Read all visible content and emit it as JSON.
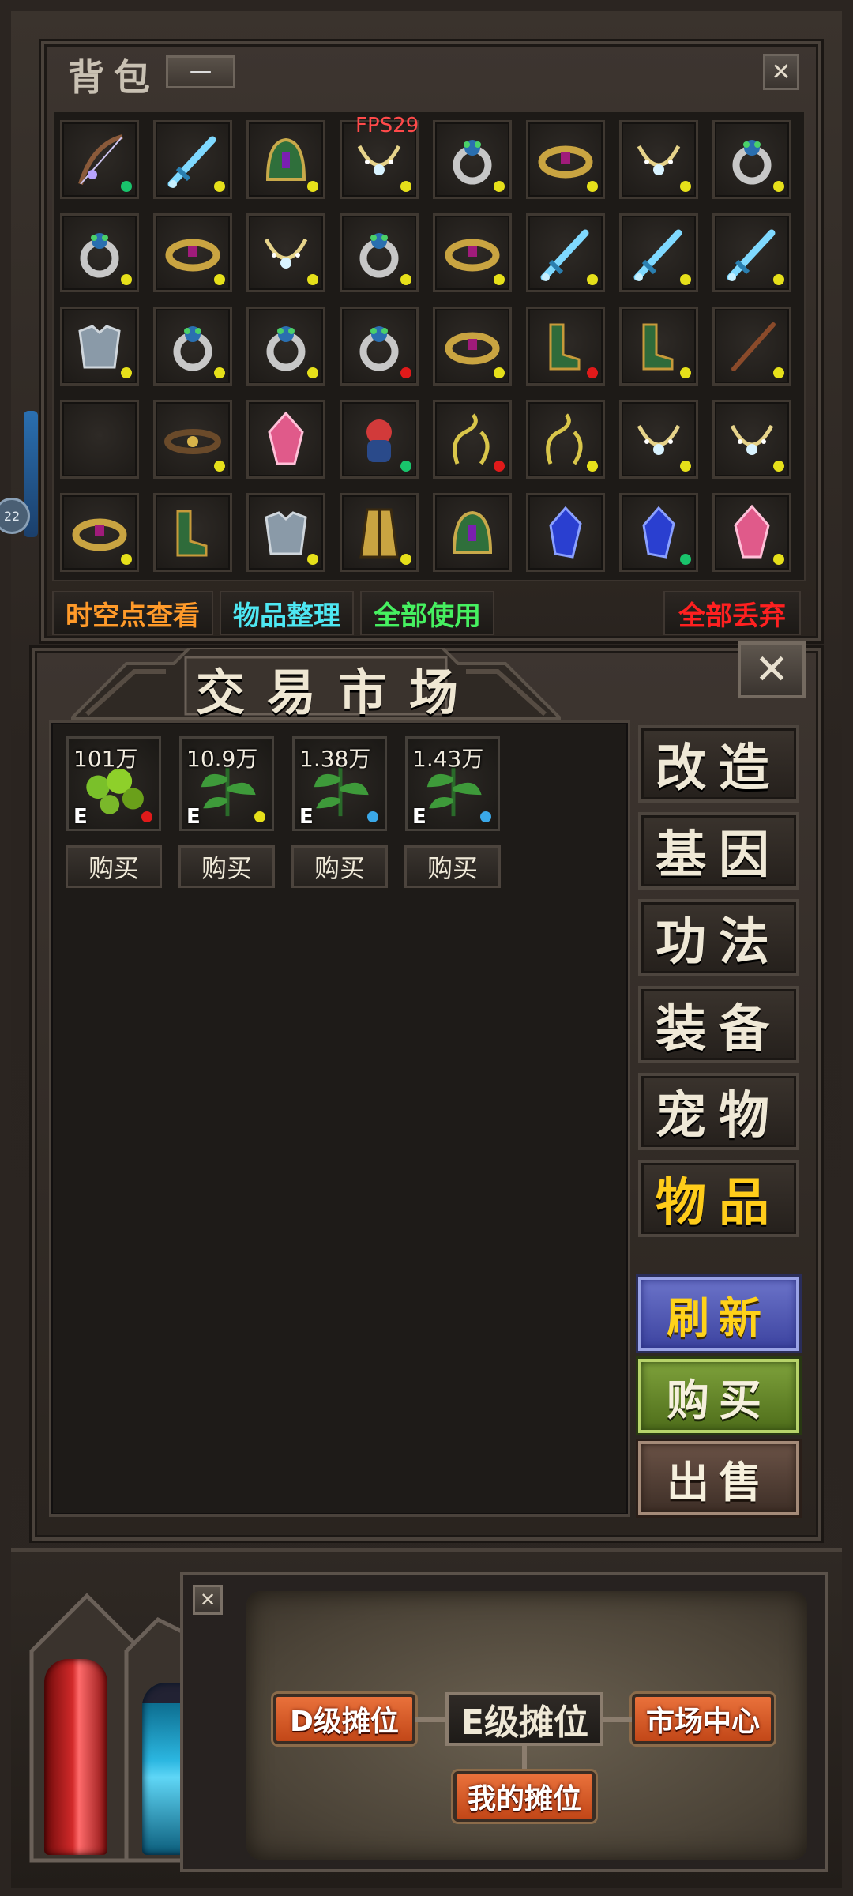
{
  "fps": "FPS29",
  "bag": {
    "title": "背包",
    "minimize_label": "一",
    "close_label": "✕",
    "items": [
      {
        "icon": "bow-icon",
        "dot": "#19c46c"
      },
      {
        "icon": "sword-icon",
        "dot": "#e6e01a"
      },
      {
        "icon": "helmet-icon",
        "dot": "#e6e01a"
      },
      {
        "icon": "necklace-icon",
        "dot": "#e6e01a"
      },
      {
        "icon": "ring-icon",
        "dot": "#e6e01a"
      },
      {
        "icon": "bracelet-icon",
        "dot": "#e6e01a"
      },
      {
        "icon": "necklace-icon",
        "dot": "#e6e01a"
      },
      {
        "icon": "ring-icon",
        "dot": "#e6e01a"
      },
      {
        "icon": "ring-icon",
        "dot": "#e6e01a"
      },
      {
        "icon": "bracelet-icon",
        "dot": "#e6e01a"
      },
      {
        "icon": "necklace-icon",
        "dot": "#e6e01a"
      },
      {
        "icon": "ring-icon",
        "dot": "#e6e01a"
      },
      {
        "icon": "bracelet-icon",
        "dot": "#e6e01a"
      },
      {
        "icon": "sword-icon",
        "dot": "#e6e01a"
      },
      {
        "icon": "sword-icon",
        "dot": "#e6e01a"
      },
      {
        "icon": "sword-icon",
        "dot": "#e6e01a"
      },
      {
        "icon": "armor-icon",
        "dot": "#e6e01a"
      },
      {
        "icon": "ring-icon",
        "dot": "#e6e01a"
      },
      {
        "icon": "ring-icon",
        "dot": "#e6e01a"
      },
      {
        "icon": "ring-icon",
        "dot": "#e01a1a"
      },
      {
        "icon": "bracelet-icon",
        "dot": "#e6e01a"
      },
      {
        "icon": "boots-icon",
        "dot": "#e01a1a"
      },
      {
        "icon": "boots-icon",
        "dot": "#e6e01a"
      },
      {
        "icon": "staff-icon",
        "dot": "#e6e01a"
      },
      {
        "icon": "empty-slot",
        "dot": ""
      },
      {
        "icon": "belt-icon",
        "dot": "#e6e01a"
      },
      {
        "icon": "crystal-icon",
        "dot": ""
      },
      {
        "icon": "pet-icon",
        "dot": "#19c46c"
      },
      {
        "icon": "vine-icon",
        "dot": "#e01a1a"
      },
      {
        "icon": "vine-icon",
        "dot": "#e6e01a"
      },
      {
        "icon": "necklace-icon",
        "dot": "#e6e01a"
      },
      {
        "icon": "necklace-icon",
        "dot": "#e6e01a"
      },
      {
        "icon": "bracelet-icon",
        "dot": "#e6e01a"
      },
      {
        "icon": "boots-icon",
        "dot": ""
      },
      {
        "icon": "armor-icon",
        "dot": "#e6e01a"
      },
      {
        "icon": "cape-icon",
        "dot": "#e6e01a"
      },
      {
        "icon": "helmet-icon",
        "dot": ""
      },
      {
        "icon": "gem-icon",
        "dot": ""
      },
      {
        "icon": "gem-icon",
        "dot": "#19c46c"
      },
      {
        "icon": "crystal-icon",
        "dot": "#e6e01a"
      }
    ],
    "actions": {
      "timespace": "时空点查看",
      "sort": "物品整理",
      "use_all": "全部使用",
      "discard_all": "全部丢弃"
    }
  },
  "market": {
    "title": "交易市场",
    "close_label": "✕",
    "items": [
      {
        "price": "101万",
        "grade": "E",
        "icon": "herb-pod-icon",
        "dot": "#e01a1a",
        "buy": "购买"
      },
      {
        "price": "10.9万",
        "grade": "E",
        "icon": "herb-leaf-icon",
        "dot": "#e6e01a",
        "buy": "购买"
      },
      {
        "price": "1.38万",
        "grade": "E",
        "icon": "herb-leaf-icon",
        "dot": "#3aa8e8",
        "buy": "购买"
      },
      {
        "price": "1.43万",
        "grade": "E",
        "icon": "herb-leaf-icon",
        "dot": "#3aa8e8",
        "buy": "购买"
      }
    ],
    "categories": [
      "改造",
      "基因",
      "功法",
      "装备",
      "宠物",
      "物品"
    ],
    "active_category": "物品",
    "refresh": "刷新",
    "buy": "购买",
    "sell": "出售"
  },
  "stall": {
    "close_label": "✕",
    "d_stall": "D级摊位",
    "e_stall": "E级摊位",
    "market_center": "市场中心",
    "my_stall": "我的摊位"
  },
  "side_badge": "22"
}
